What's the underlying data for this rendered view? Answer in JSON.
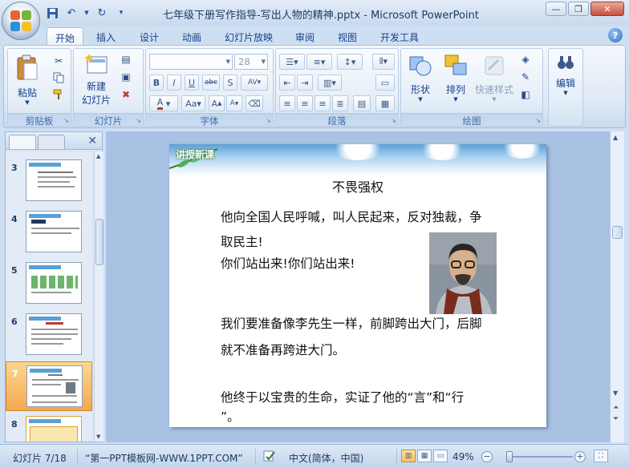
{
  "window": {
    "title": "七年级下册写作指导-写出人物的精神.pptx - Microsoft PowerPoint",
    "minimize_icon": "minimize-icon",
    "maximize_icon": "restore-icon",
    "close_icon": "close-icon"
  },
  "ribbon": {
    "tabs": [
      "开始",
      "插入",
      "设计",
      "动画",
      "幻灯片放映",
      "审阅",
      "视图",
      "开发工具"
    ],
    "active_tab": "开始",
    "groups": {
      "clipboard": {
        "label": "剪贴板",
        "paste": "粘贴"
      },
      "slides": {
        "label": "幻灯片",
        "new_slide_line1": "新建",
        "new_slide_line2": "幻灯片"
      },
      "font": {
        "label": "字体",
        "font_name": "",
        "font_size": "28"
      },
      "paragraph": {
        "label": "段落"
      },
      "drawing": {
        "label": "绘图",
        "shapes": "形状",
        "arrange": "排列",
        "quick_styles": "快速样式"
      },
      "editing": {
        "label": "编辑",
        "edit": "编辑"
      }
    }
  },
  "slides_pane": {
    "numbers": [
      "3",
      "4",
      "5",
      "6",
      "7",
      "8"
    ],
    "selected": "7"
  },
  "slide": {
    "tag": "讲授新课",
    "title": "不畏强权",
    "lines": [
      "他向全国人民呼喊，叫人民起来，反对独裁，争",
      "取民主!",
      "你们站出来!你们站出来!",
      "我们要准备像李先生一样，前脚跨出大门，后脚",
      "就不准备再跨进大门。",
      "他终于以宝贵的生命，实证了他的“言”和“行",
      "”。"
    ]
  },
  "statusbar": {
    "slide_info": "幻灯片 7/18",
    "theme": "“第一PPT模板网-WWW.1PPT.COM”",
    "language": "中文(简体，中国)",
    "zoom": "49%",
    "zoom_fraction": 0.49
  },
  "colors": {
    "accent": "#15428b",
    "ribbon_bg": "#dfe9f5",
    "selection": "#f3a84e"
  }
}
